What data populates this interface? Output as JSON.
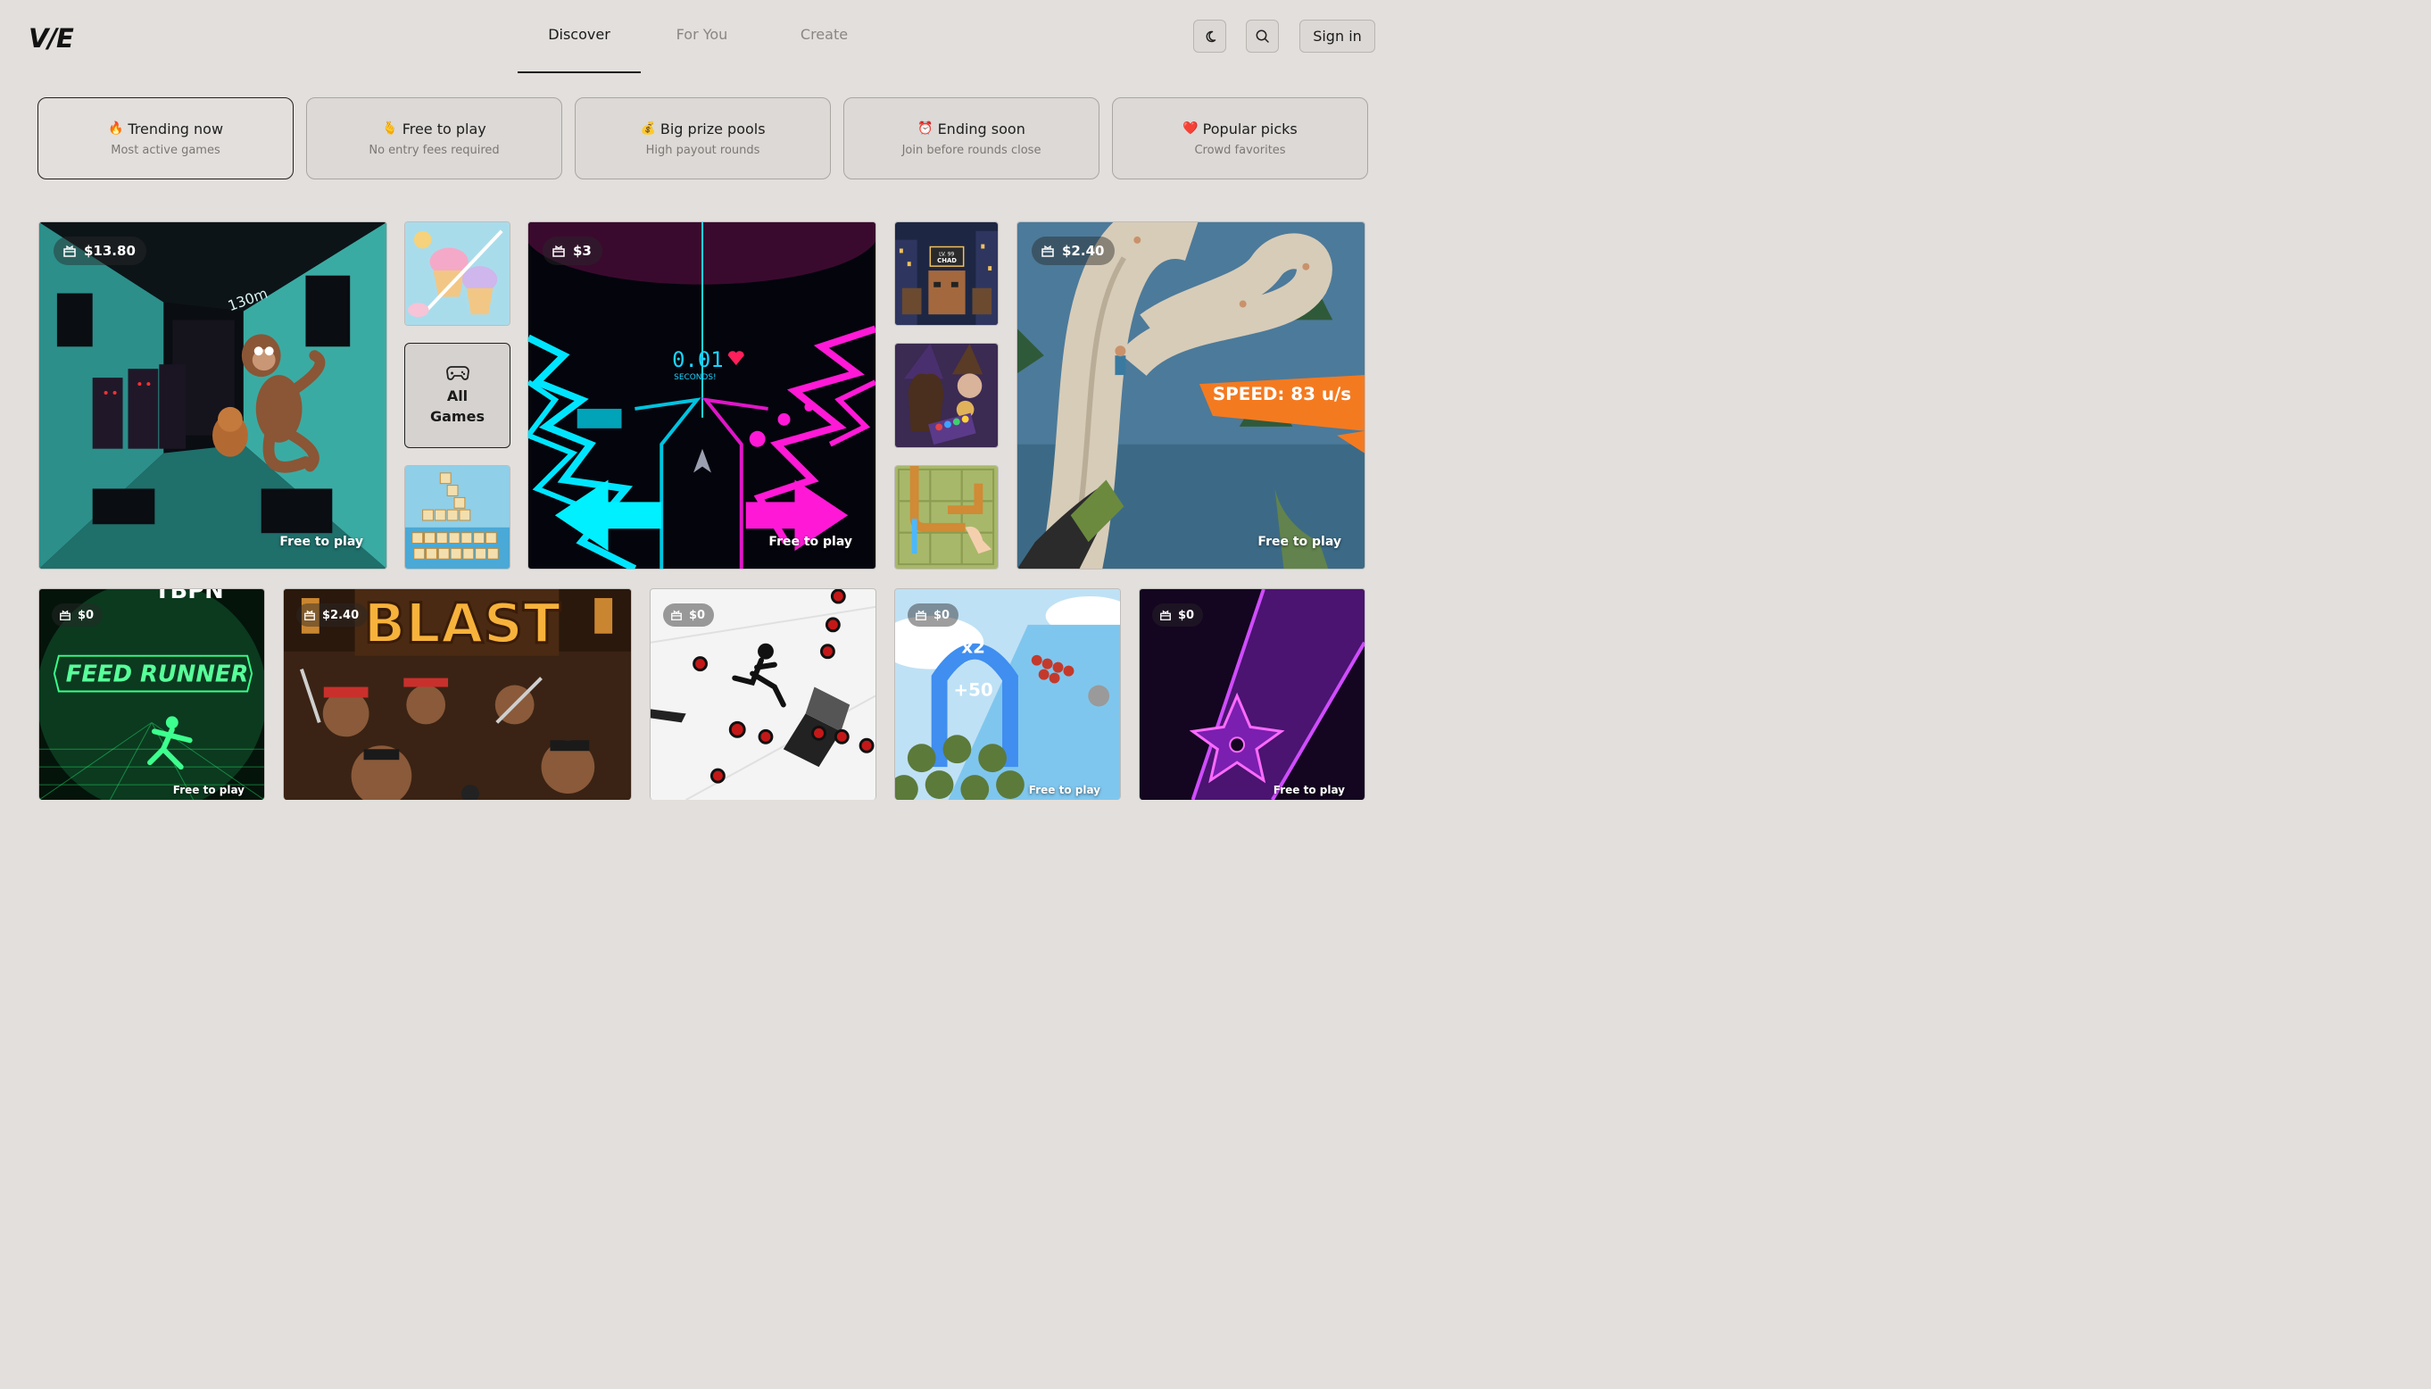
{
  "header": {
    "logo": "V/E",
    "tabs": [
      {
        "label": "Discover"
      },
      {
        "label": "For You"
      },
      {
        "label": "Create"
      }
    ],
    "sign_in": "Sign in",
    "icons": {
      "theme": "moon-icon",
      "search": "search-icon"
    }
  },
  "filters": [
    {
      "emoji": "🔥",
      "title": "Trending now",
      "subtitle": "Most active games"
    },
    {
      "emoji": "🫰",
      "title": "Free to play",
      "subtitle": "No entry fees required"
    },
    {
      "emoji": "💰",
      "title": "Big prize pools",
      "subtitle": "High payout rounds"
    },
    {
      "emoji": "⏰",
      "title": "Ending soon",
      "subtitle": "Join before rounds close"
    },
    {
      "emoji": "❤️",
      "title": "Popular picks",
      "subtitle": "Crowd favorites"
    }
  ],
  "all_games": {
    "line1": "All",
    "line2": "Games"
  },
  "featured": [
    {
      "prize": "$13.80",
      "tag": "Free to play",
      "art_text": "130m"
    },
    {
      "prize": "$3",
      "tag": "Free to play",
      "art_text": "0.01",
      "art_sub": "SECONDS!"
    },
    {
      "prize": "$2.40",
      "tag": "Free to play",
      "art_text": "SPEED: 83 u/s"
    }
  ],
  "small_art": {
    "chad": "CHAD",
    "chad_level": "LV. 99"
  },
  "bottom_row": [
    {
      "prize": "$0",
      "tag": "Free to play",
      "art_title": "FEED RUNNER",
      "art_top": "TBPN"
    },
    {
      "prize": "$2.40",
      "art_title": "BLAST"
    },
    {
      "prize": "$0"
    },
    {
      "prize": "$0",
      "tag": "Free to play",
      "art_a": "x2",
      "art_b": "+50"
    },
    {
      "prize": "$0",
      "tag": "Free to play"
    }
  ],
  "colors": {
    "background": "#e2dfdc",
    "accent": "#1a1a1a",
    "neon_cyan": "#00e5ff",
    "neon_pink": "#ff19d7",
    "speed_orange": "#f47a20"
  }
}
